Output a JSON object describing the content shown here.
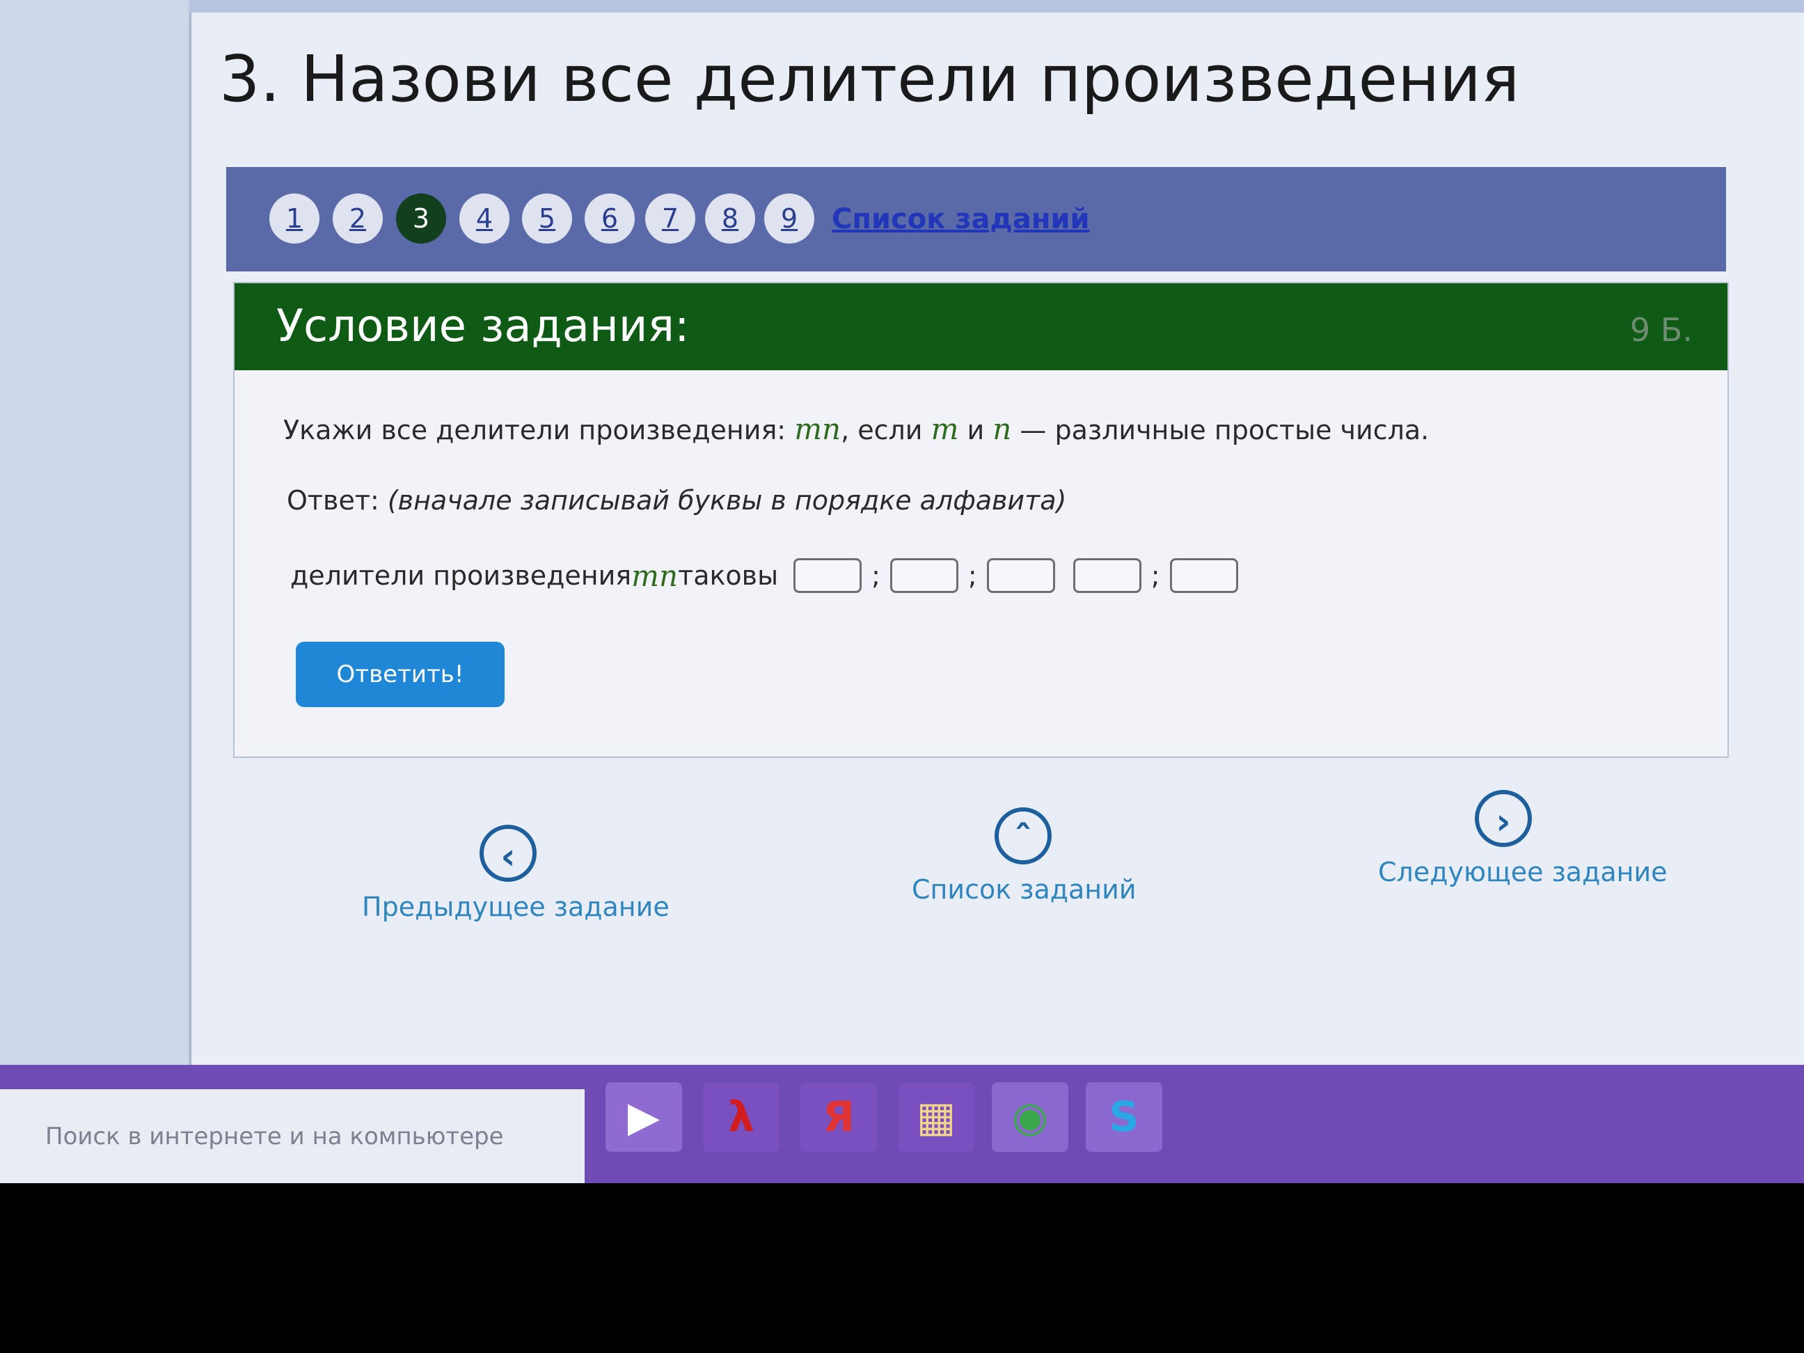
{
  "page": {
    "title": "3. Назови все делители произведения"
  },
  "steps": {
    "items": [
      "1",
      "2",
      "3",
      "4",
      "5",
      "6",
      "7",
      "8",
      "9"
    ],
    "active_index": 2,
    "list_link": "Список заданий"
  },
  "task": {
    "header_title": "Условие задания:",
    "points": "9 Б.",
    "text_before": "Укажи все делители произведения: ",
    "var_mn": "mn",
    "text_if": ", если ",
    "var_m": "m",
    "text_and": " и ",
    "var_n": "n",
    "text_after": " — различные простые числа.",
    "answer_label": "Ответ: ",
    "answer_hint": "(вначале записывай буквы в порядке алфавита)",
    "divisors_label": "делители произведения ",
    "divisors_var": "mn",
    "divisors_suffix": " таковы",
    "separator": ";",
    "inputs": [
      "",
      "",
      "",
      "",
      ""
    ],
    "submit_label": "Ответить!"
  },
  "navigation": {
    "prev_label": "Предыдущее задание",
    "list_label": "Список заданий",
    "next_label": "Следующее задание"
  },
  "taskbar": {
    "search_placeholder": "Поиск в интернете и на компьютере",
    "icons": [
      "media-player-icon",
      "pdf-reader-icon",
      "yandex-browser-icon",
      "file-explorer-icon",
      "chrome-icon",
      "skype-icon"
    ]
  },
  "colors": {
    "header_green": "#0f5a14",
    "step_bar": "#5a6aa8",
    "link_blue": "#2136b8",
    "button_blue": "#1f87d6",
    "variable_green": "#2d6b1e"
  }
}
